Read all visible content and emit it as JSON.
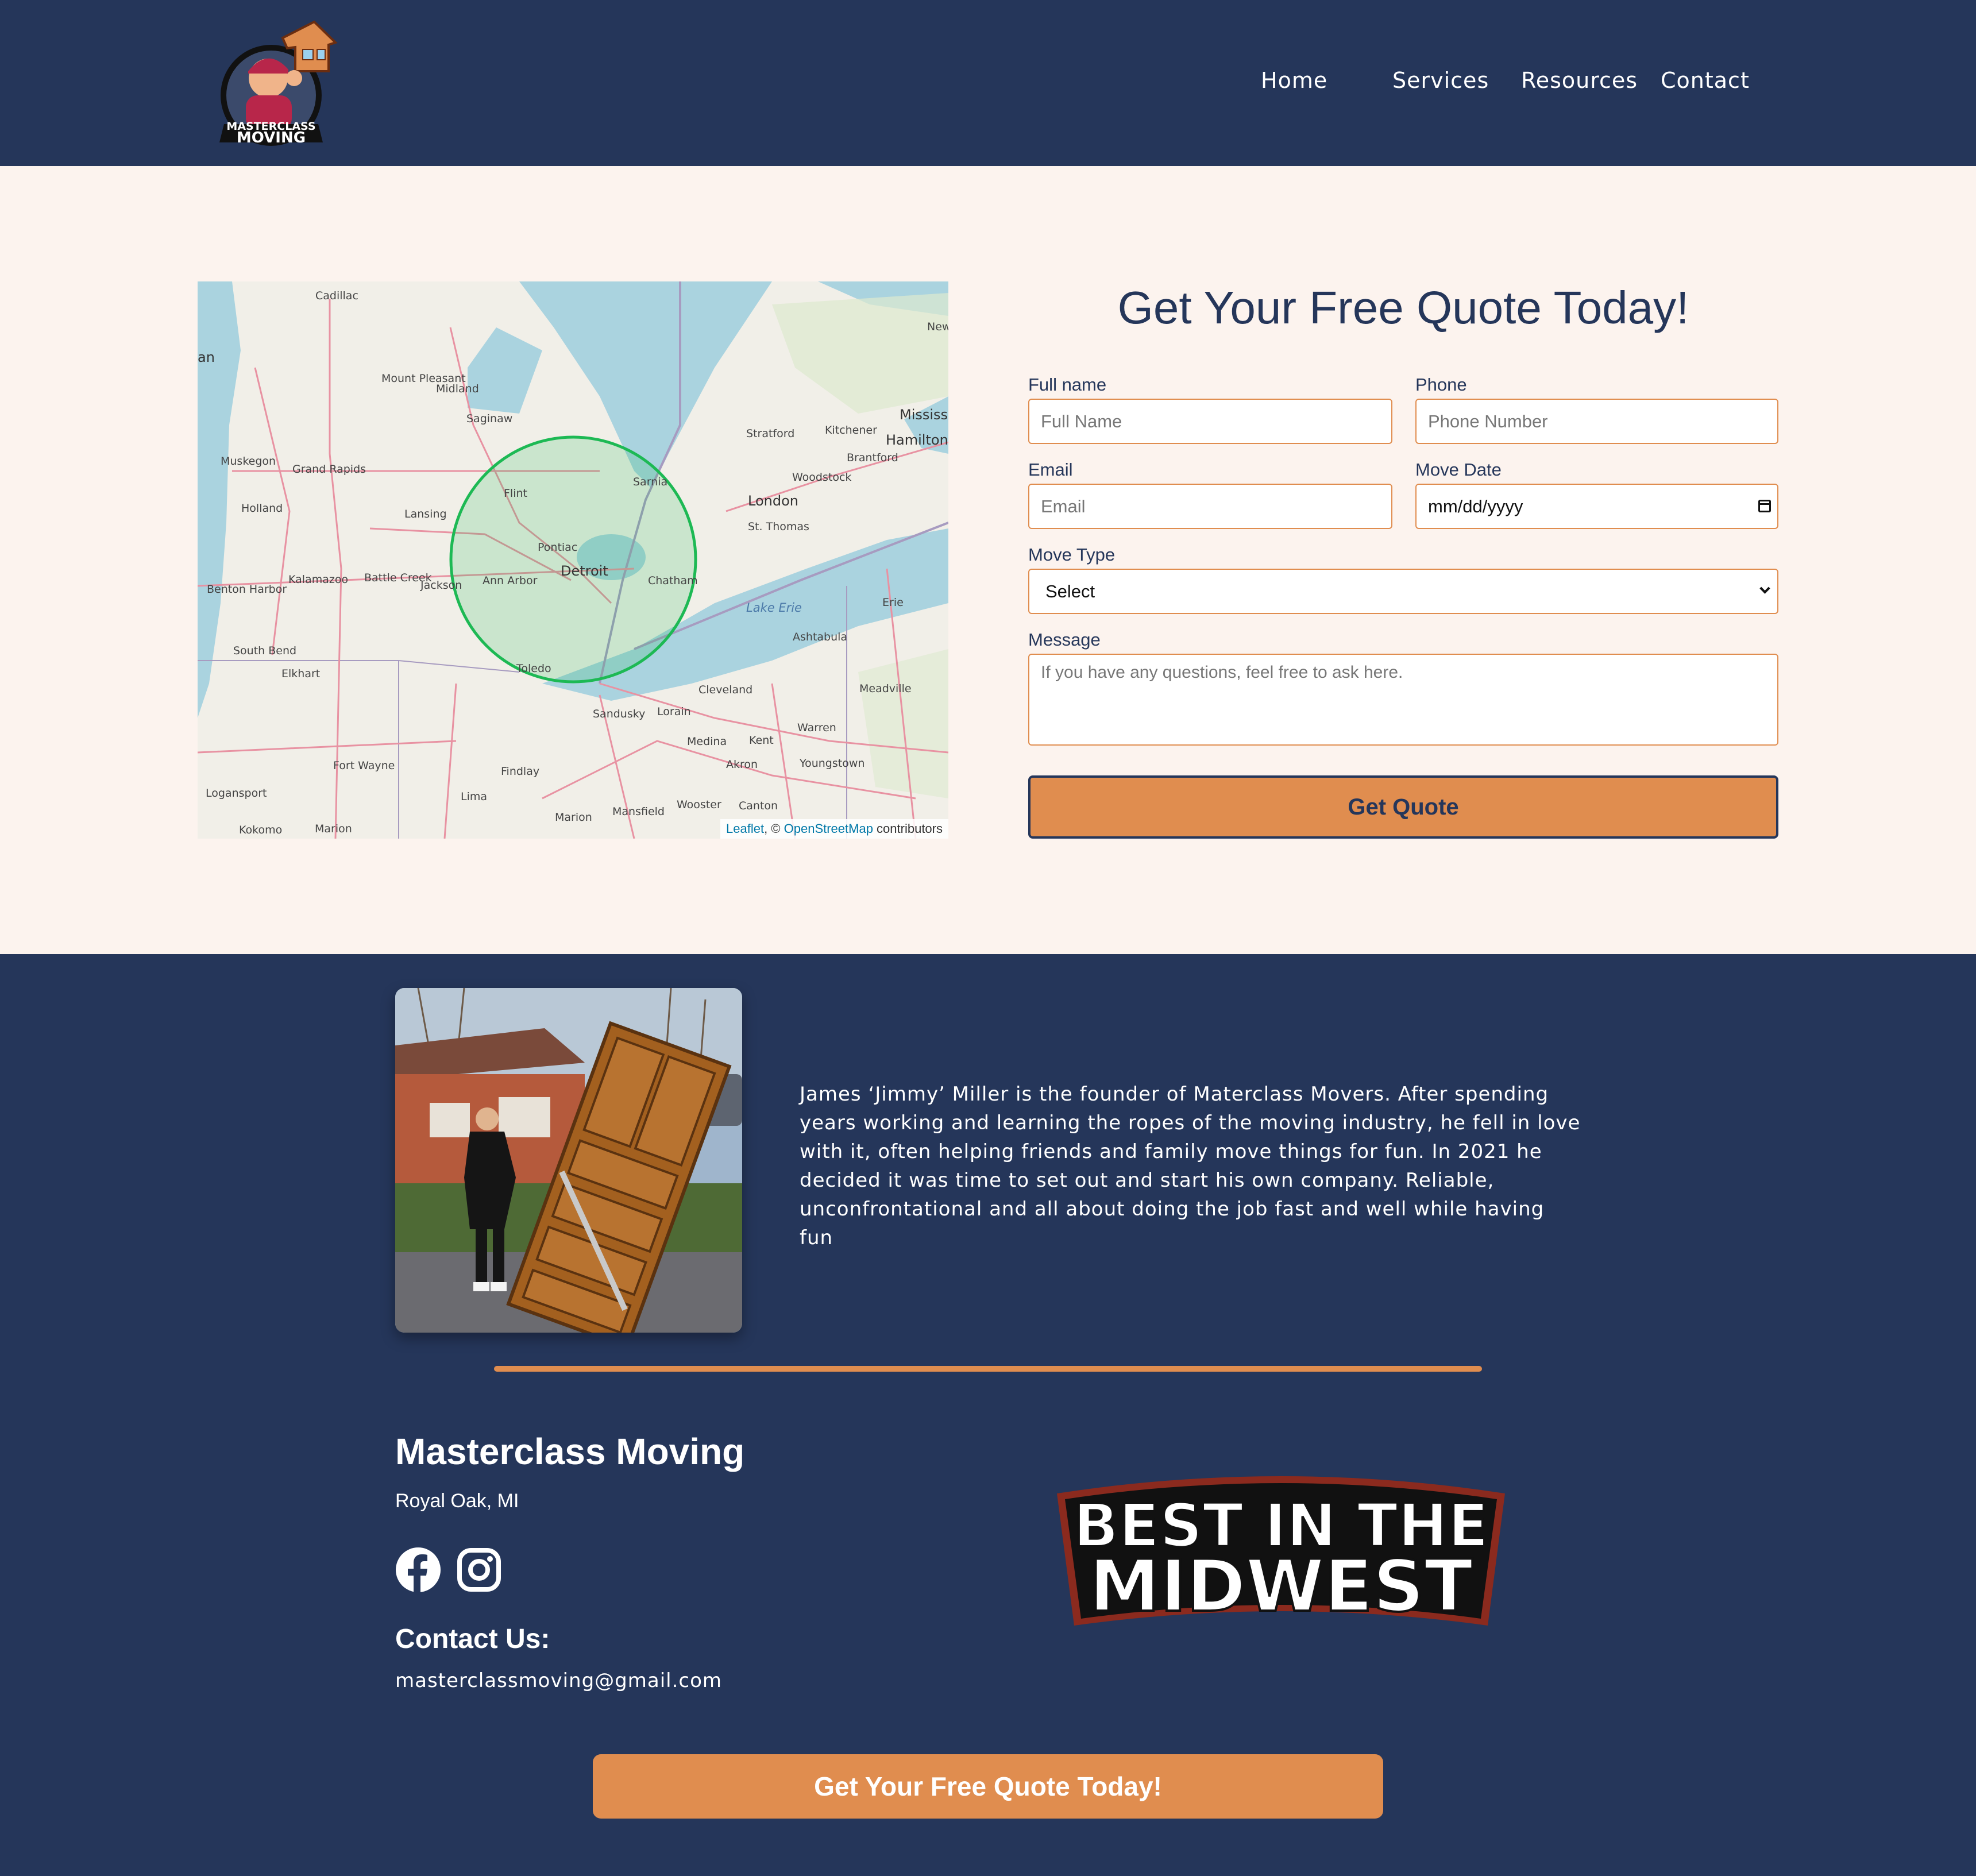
{
  "header": {
    "logo_text_top": "MASTERCLASS",
    "logo_text_bottom": "MOVING",
    "nav": [
      {
        "label": "Home"
      },
      {
        "label": "Services"
      },
      {
        "label": "Resources"
      },
      {
        "label": "Contact"
      }
    ]
  },
  "map": {
    "labels": [
      "Cadillac",
      "Mount Pleasant",
      "Midland",
      "Saginaw",
      "Muskegon",
      "Grand Rapids",
      "Holland",
      "Lansing",
      "Flint",
      "Pontiac",
      "Detroit",
      "Ann Arbor",
      "Jackson",
      "Battle Creek",
      "Kalamazoo",
      "Benton Harbor",
      "South Bend",
      "Elkhart",
      "Toledo",
      "Sarnia",
      "London",
      "St. Thomas",
      "Chatham",
      "Stratford",
      "Kitchener",
      "Hamilton",
      "Brantford",
      "Woodstock",
      "Mississ",
      "New",
      "Erie",
      "Ashtabula",
      "Meadville",
      "Cleveland",
      "Lorain",
      "Sandusky",
      "Medina",
      "Kent",
      "Akron",
      "Warren",
      "Youngstown",
      "Canton",
      "Wooster",
      "Mansfield",
      "Marion",
      "Findlay",
      "Lima",
      "Fort Wayne",
      "Logansport",
      "Kokomo",
      "Marion",
      "Lake Erie",
      "an"
    ],
    "attribution": {
      "leaflet": "Leaflet",
      "sep": ", © ",
      "osm": "OpenStreetMap",
      "suffix": " contributors"
    },
    "service_area_color": "#1db954"
  },
  "quote_form": {
    "title": "Get Your Free Quote Today!",
    "full_name": {
      "label": "Full name",
      "placeholder": "Full Name"
    },
    "phone": {
      "label": "Phone",
      "placeholder": "Phone Number"
    },
    "email": {
      "label": "Email",
      "placeholder": "Email"
    },
    "move_date": {
      "label": "Move Date",
      "value": "mm/dd/yyyy"
    },
    "move_type": {
      "label": "Move Type",
      "selected": "Select"
    },
    "message": {
      "label": "Message",
      "placeholder": "If you have any questions, feel free to ask here."
    },
    "submit_label": "Get Quote"
  },
  "about": {
    "bio": "James ‘Jimmy’ Miller is the founder of Materclass Movers. After spending years working and learning the ropes of the moving industry, he fell in love with it, often helping friends and family move things for fun. In 2021 he decided it was time to set out and start his own company. Reliable, unconfrontational and all about doing the job fast and well while having fun"
  },
  "footer": {
    "business_name": "Masterclass Moving",
    "city": "Royal Oak, MI",
    "social": [
      {
        "icon": "facebook-icon"
      },
      {
        "icon": "instagram-icon"
      }
    ],
    "contact_heading": "Contact Us:",
    "email": "masterclassmoving@gmail.com",
    "badge_line1": "BEST IN THE",
    "badge_line2": "MIDWEST",
    "cta_label": "Get Your Free Quote Today!"
  },
  "colors": {
    "navy": "#25365a",
    "accent": "#e08d4f",
    "cream": "#fcf3ee"
  }
}
